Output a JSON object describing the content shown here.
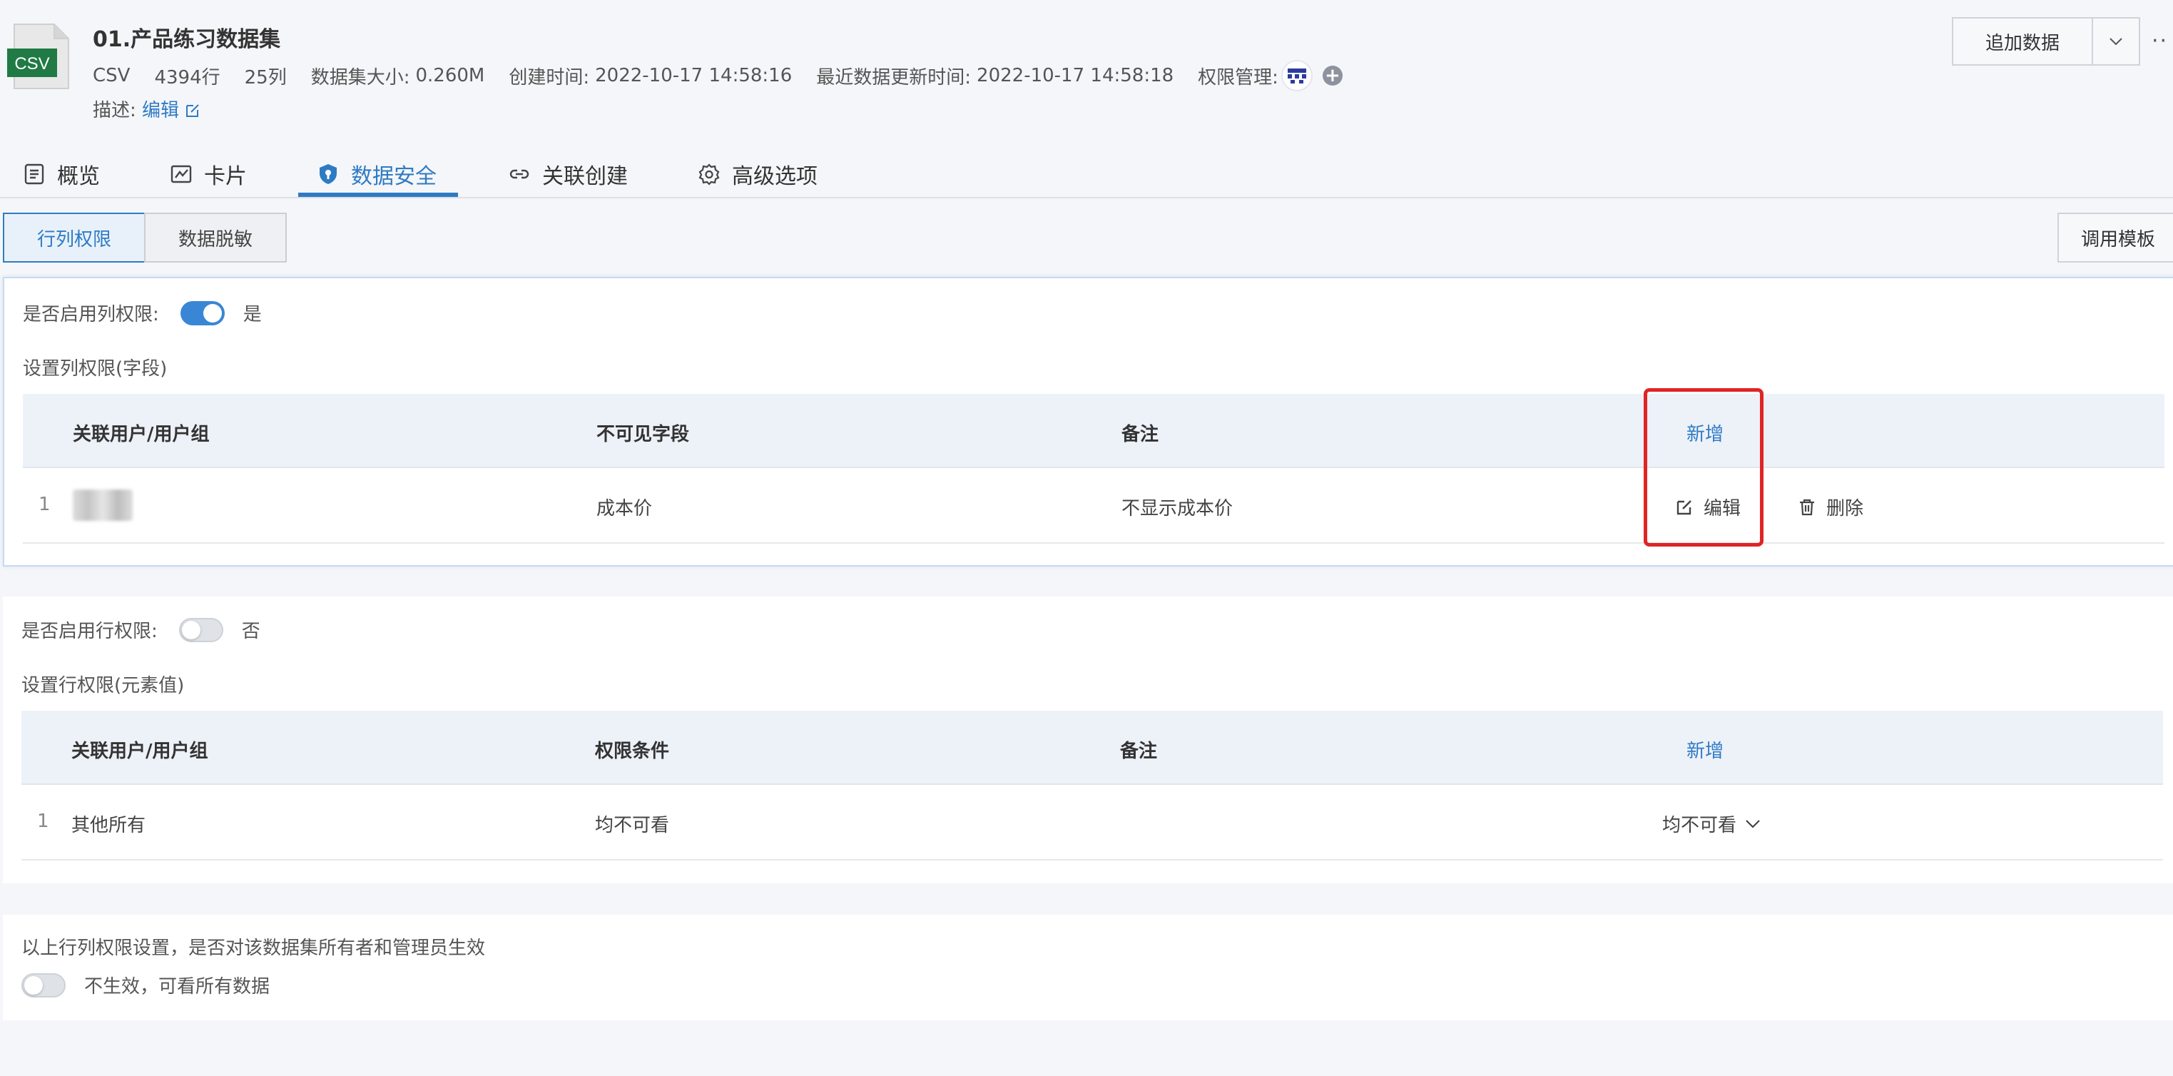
{
  "dataset": {
    "icon_label": "CSV",
    "title": "01.产品练习数据集",
    "format": "CSV",
    "rows": "4394行",
    "cols": "25列",
    "size_label": "数据集大小:",
    "size": "0.260M",
    "created_label": "创建时间:",
    "created": "2022-10-17 14:58:16",
    "updated_label": "最近数据更新时间:",
    "updated": "2022-10-17 14:58:18",
    "perm_label": "权限管理:",
    "desc_label": "描述:",
    "desc_edit": "编辑"
  },
  "actions": {
    "add_data": "追加数据",
    "more": "··"
  },
  "tabs": [
    {
      "label": "概览",
      "icon": "document-icon"
    },
    {
      "label": "卡片",
      "icon": "chart-icon"
    },
    {
      "label": "数据安全",
      "icon": "shield-icon",
      "active": true
    },
    {
      "label": "关联创建",
      "icon": "link-icon"
    },
    {
      "label": "高级选项",
      "icon": "gear-icon"
    }
  ],
  "subtabs": {
    "row_col": "行列权限",
    "masking": "数据脱敏",
    "template": "调用模板"
  },
  "col_perm": {
    "enable_label": "是否启用列权限:",
    "enabled": true,
    "enabled_text": "是",
    "section_title": "设置列权限(字段)",
    "headers": [
      "关联用户/用户组",
      "不可见字段",
      "备注",
      "新增"
    ],
    "rows": [
      {
        "index": "1",
        "field": "成本价",
        "note": "不显示成本价",
        "edit": "编辑",
        "delete": "删除"
      }
    ]
  },
  "row_perm": {
    "enable_label": "是否启用行权限:",
    "enabled": false,
    "enabled_text": "否",
    "section_title": "设置行权限(元素值)",
    "headers": [
      "关联用户/用户组",
      "权限条件",
      "备注",
      "新增"
    ],
    "rows": [
      {
        "index": "1",
        "user": "其他所有",
        "condition": "均不可看",
        "note": "",
        "action": "均不可看"
      }
    ]
  },
  "owner_effect": {
    "question": "以上行列权限设置，是否对该数据集所有者和管理员生效",
    "enabled": false,
    "status": "不生效，可看所有数据"
  },
  "colors": {
    "accent": "#2e7bc4",
    "highlight": "#e02424",
    "csv_green": "#1f7a44"
  }
}
